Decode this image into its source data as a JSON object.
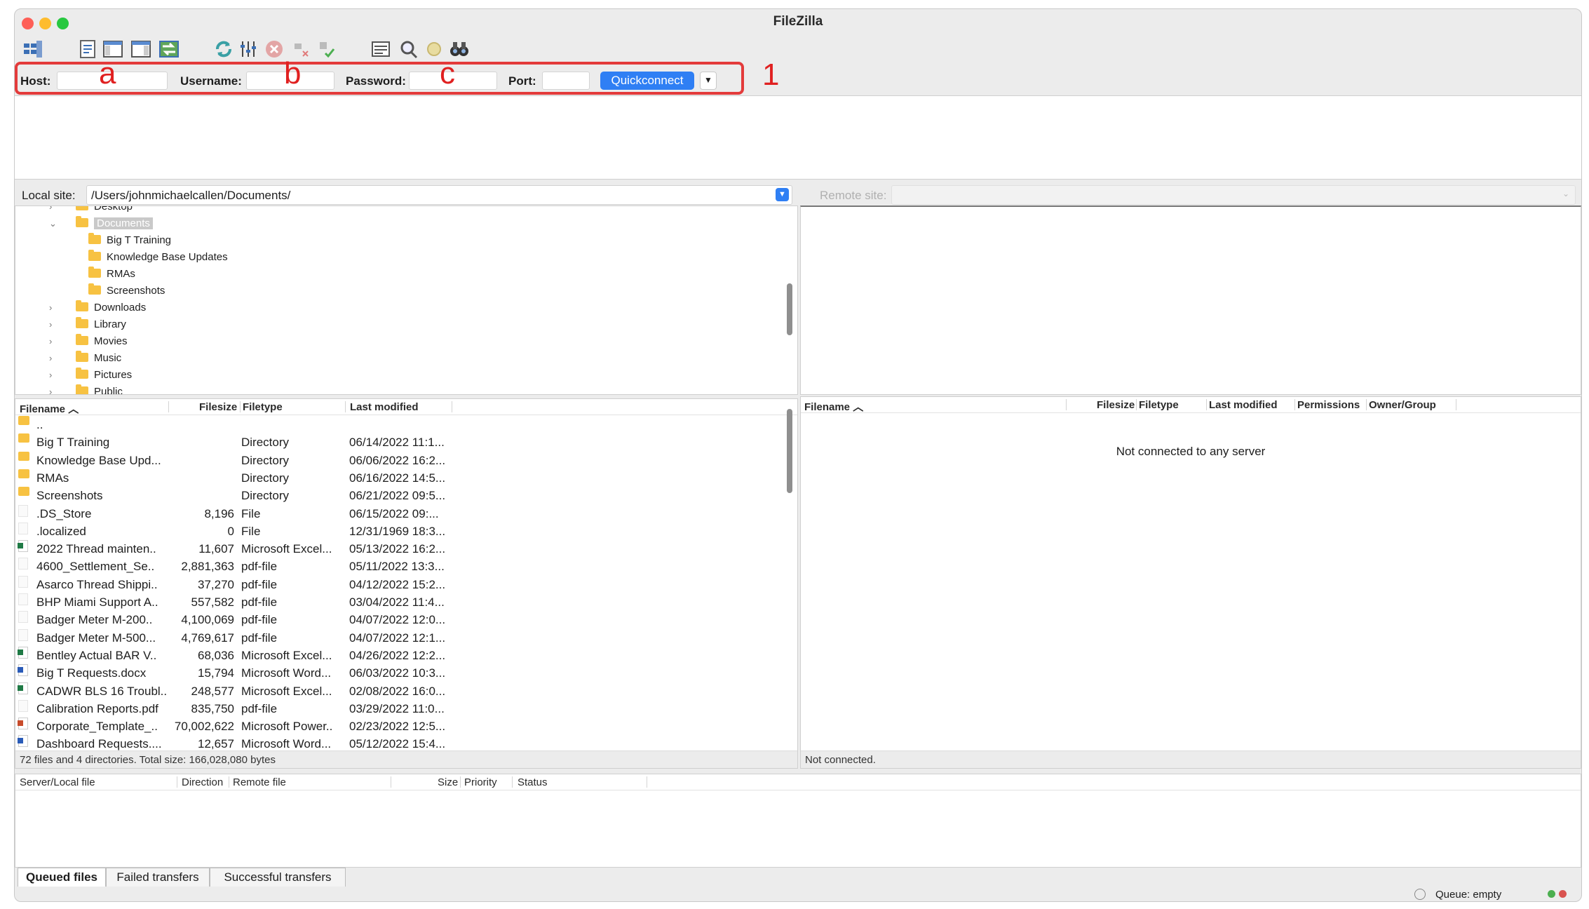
{
  "window": {
    "title": "FileZilla"
  },
  "toolbar": {
    "icons": [
      "site-manager-icon",
      "message-log-icon",
      "local-tree-icon",
      "remote-tree-icon",
      "transfer-queue-icon",
      "refresh-icon",
      "filter-icon",
      "cancel-icon",
      "disconnect-icon",
      "reconnect-icon",
      "directory-compare-icon",
      "search-icon",
      "sync-browse-icon",
      "find-files-icon"
    ]
  },
  "quickconnect": {
    "host_label": "Host:",
    "host_value": "",
    "username_label": "Username:",
    "username_value": "",
    "password_label": "Password:",
    "password_value": "",
    "port_label": "Port:",
    "port_value": "",
    "button_label": "Quickconnect"
  },
  "annotations": {
    "a": "a",
    "b": "b",
    "c": "c",
    "one": "1",
    "highlight_color": "#e33b3b"
  },
  "local": {
    "site_label": "Local site:",
    "site_path": "/Users/johnmichaelcallen/Documents/",
    "tree": [
      {
        "label": "Desktop",
        "level": 1,
        "expander": ">"
      },
      {
        "label": "Documents",
        "level": 1,
        "expander": "v",
        "selected": true
      },
      {
        "label": "Big T Training",
        "level": 2,
        "expander": ""
      },
      {
        "label": "Knowledge Base Updates",
        "level": 2,
        "expander": ""
      },
      {
        "label": "RMAs",
        "level": 2,
        "expander": ""
      },
      {
        "label": "Screenshots",
        "level": 2,
        "expander": ""
      },
      {
        "label": "Downloads",
        "level": 1,
        "expander": ">"
      },
      {
        "label": "Library",
        "level": 1,
        "expander": ">"
      },
      {
        "label": "Movies",
        "level": 1,
        "expander": ">"
      },
      {
        "label": "Music",
        "level": 1,
        "expander": ">"
      },
      {
        "label": "Pictures",
        "level": 1,
        "expander": ">"
      },
      {
        "label": "Public",
        "level": 1,
        "expander": ">"
      }
    ],
    "columns": {
      "filename": "Filename",
      "filesize": "Filesize",
      "filetype": "Filetype",
      "modified": "Last modified"
    },
    "files": [
      {
        "icon": "folder",
        "name": "..",
        "size": "",
        "type": "",
        "modified": ""
      },
      {
        "icon": "folder",
        "name": "Big T Training",
        "size": "",
        "type": "Directory",
        "modified": "06/14/2022 11:1..."
      },
      {
        "icon": "folder",
        "name": "Knowledge Base Upd...",
        "size": "",
        "type": "Directory",
        "modified": "06/06/2022 16:2..."
      },
      {
        "icon": "folder",
        "name": "RMAs",
        "size": "",
        "type": "Directory",
        "modified": "06/16/2022 14:5..."
      },
      {
        "icon": "folder",
        "name": "Screenshots",
        "size": "",
        "type": "Directory",
        "modified": "06/21/2022 09:5..."
      },
      {
        "icon": "blank",
        "name": ".DS_Store",
        "size": "8,196",
        "type": "File",
        "modified": "06/15/2022 09:..."
      },
      {
        "icon": "blank",
        "name": ".localized",
        "size": "0",
        "type": "File",
        "modified": "12/31/1969 18:3..."
      },
      {
        "icon": "excel",
        "name": "2022 Thread mainten..",
        "size": "11,607",
        "type": "Microsoft Excel...",
        "modified": "05/13/2022 16:2..."
      },
      {
        "icon": "blank",
        "name": "4600_Settlement_Se..",
        "size": "2,881,363",
        "type": "pdf-file",
        "modified": "05/11/2022 13:3..."
      },
      {
        "icon": "blank",
        "name": "Asarco Thread Shippi..",
        "size": "37,270",
        "type": "pdf-file",
        "modified": "04/12/2022 15:2..."
      },
      {
        "icon": "blank",
        "name": "BHP Miami Support A..",
        "size": "557,582",
        "type": "pdf-file",
        "modified": "03/04/2022 11:4..."
      },
      {
        "icon": "blank",
        "name": "Badger Meter M-200..",
        "size": "4,100,069",
        "type": "pdf-file",
        "modified": "04/07/2022 12:0..."
      },
      {
        "icon": "blank",
        "name": "Badger Meter M-500...",
        "size": "4,769,617",
        "type": "pdf-file",
        "modified": "04/07/2022 12:1..."
      },
      {
        "icon": "excel",
        "name": "Bentley Actual BAR V..",
        "size": "68,036",
        "type": "Microsoft Excel...",
        "modified": "04/26/2022 12:2..."
      },
      {
        "icon": "word",
        "name": "Big T Requests.docx",
        "size": "15,794",
        "type": "Microsoft Word...",
        "modified": "06/03/2022 10:3..."
      },
      {
        "icon": "excel",
        "name": "CADWR BLS 16 Troubl..",
        "size": "248,577",
        "type": "Microsoft Excel...",
        "modified": "02/08/2022 16:0..."
      },
      {
        "icon": "blank",
        "name": "Calibration Reports.pdf",
        "size": "835,750",
        "type": "pdf-file",
        "modified": "03/29/2022 11:0..."
      },
      {
        "icon": "ppt",
        "name": "Corporate_Template_..",
        "size": "70,002,622",
        "type": "Microsoft Power..",
        "modified": "02/23/2022 12:5..."
      },
      {
        "icon": "word",
        "name": "Dashboard Requests....",
        "size": "12,657",
        "type": "Microsoft Word...",
        "modified": "05/12/2022 15:4..."
      }
    ],
    "status": "72 files and 4 directories. Total size: 166,028,080 bytes"
  },
  "remote": {
    "site_label": "Remote site:",
    "site_path": "",
    "columns": {
      "filename": "Filename",
      "filesize": "Filesize",
      "filetype": "Filetype",
      "modified": "Last modified",
      "permissions": "Permissions",
      "owner": "Owner/Group"
    },
    "empty_message": "Not connected to any server",
    "status": "Not connected."
  },
  "queue": {
    "columns": {
      "server": "Server/Local file",
      "direction": "Direction",
      "remote": "Remote file",
      "size": "Size",
      "priority": "Priority",
      "status": "Status"
    },
    "tabs": [
      "Queued files",
      "Failed transfers",
      "Successful transfers"
    ],
    "status": "Queue: empty"
  },
  "colors": {
    "accent": "#2f7ff4",
    "folder": "#f7c242",
    "excel": "#1f7a45",
    "word": "#2a5bb8",
    "ppt": "#c84b2b"
  }
}
